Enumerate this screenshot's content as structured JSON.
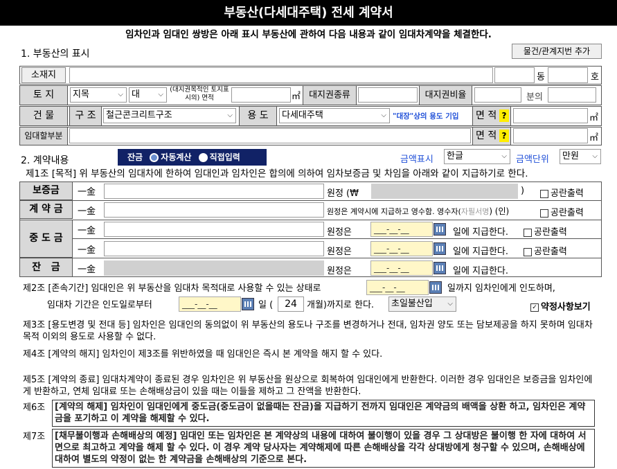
{
  "header": {
    "title": "부동산(다세대주택) 전세 계약서",
    "intro": "임차인과 임대인 쌍방은 아래 표시 부동산에 관하여 다음 내용과 같이 임대차계약을 체결한다."
  },
  "section1": {
    "title": "1. 부동산의 표시",
    "add_button": "물건/관계지번 추가",
    "address_label": "소재지",
    "dong_suffix": "동",
    "ho_suffix": "호",
    "land_label": "토 지",
    "land_jimok_value": "지목",
    "land_type_value": "대",
    "land_area_label": "(대지권목적인 토지표시의) 면적",
    "unit_m2": "㎡",
    "land_right_type_label": "대지권종류",
    "land_right_ratio_label": "대지권비율",
    "ratio_of": "분의",
    "building_label": "건 물",
    "structure_label": "구 조",
    "structure_value": "철근콘크리트구조",
    "use_label": "용 도",
    "use_value": "다세대주택",
    "use_note": "\"대장\"상의 용도 기입",
    "area_label": "면 적",
    "question": "?",
    "lease_part_label": "임대할부분"
  },
  "section2": {
    "title": "2. 계약내용",
    "balance_label": "잔금",
    "auto_calc": "자동계산",
    "direct_input": "직접입력",
    "amount_display_label": "금액표시",
    "amount_display_value": "한글",
    "amount_unit_label": "금액단위",
    "amount_unit_value": "만원",
    "article1": "제1조 [목적] 위 부동산의 임대차에 한하여 임대인과 임차인은 합의에 의하여 임차보증금 및 차임을 아래와 같이 지급하기로 한다.",
    "rows": {
      "deposit_label": "보증금",
      "contract_label": "계 약 금",
      "middle_label": "중 도 금",
      "balance_label": "잔   금",
      "il_geum": "一金",
      "won_jeong_won": "원정  (₩",
      "close_paren": ")",
      "blank_print": "공란출력",
      "contract_note": "원정은 계약시에 지급하고 영수함. 영수자(",
      "signature": "자필서명",
      "contract_note_end": ") (인)",
      "won_jeong_eun": "원정은",
      "date_placeholder": "___-__-__",
      "pay_on": "일에 지급한다.",
      "pay_on_balance": "일에 지급한다."
    },
    "article2_a": "제2조 [존속기간] 임대인은 위 부동산을 임대차 목적대로 사용할 수 있는 상태로",
    "article2_b": "일까지 임차인에게 인도하며,",
    "article2_c": "임대차 기간은 인도일로부터",
    "article2_d": "일 (",
    "article2_months": "24",
    "article2_e": "개월)까지로 한다.",
    "period_select": "초일불산입",
    "terms_view": "약정사항보기",
    "article3": "제3조 [용도변경 및 전대 등] 임차인은 임대인의 동의없이 위 부동산의 용도나 구조를 변경하거나 전대, 임차권 양도 또는 담보제공을 하지 못하며 임대차 목적 이외의 용도로 사용할 수 없다.",
    "article4": "제4조 [계약의 해지] 임차인이 제3조를 위반하였을 때 임대인은 즉시 본 계약을 해지 할 수 있다.",
    "article5": "제5조 [계약의 종료] 임대차계약이 종료된 경우 임차인은 위 부동산을 원상으로 회복하여 임대인에게 반환한다. 이러한 경우 임대인은 보증금을 임차인에게 반환하고, 연체 임대료 또는 손해배상금이 있을 때는 이들을 제하고 그 잔액을 반환한다.",
    "article6_label": "제6조",
    "article6": "[계약의 해제] 임차인이 임대인에게 중도금(중도금이 없을때는 잔금)을 지급하기 전까지 임대인은 계약금의 배액을 상환 하고, 임차인은 계약금을 포기하고 이 계약을 해제할 수 있다.",
    "article7_label": "제7조",
    "article7": "[채무불이행과 손해배상의 예정] 임대인 또는 임차인은 본 계약상의 내용에 대하여 불이행이 있을 경우 그 상대방은 불이행 한 자에 대하여 서면으로 최고하고 계약을 해제 할 수 있다.  이 경우 계약 당사자는 계약해제에 따른 손해배상을 각각 상대방에게 청구할 수 있으며, 손해배상에 대하여 별도의 약정이 없는 한 계약금을 손해배상의 기준으로 본다."
  }
}
